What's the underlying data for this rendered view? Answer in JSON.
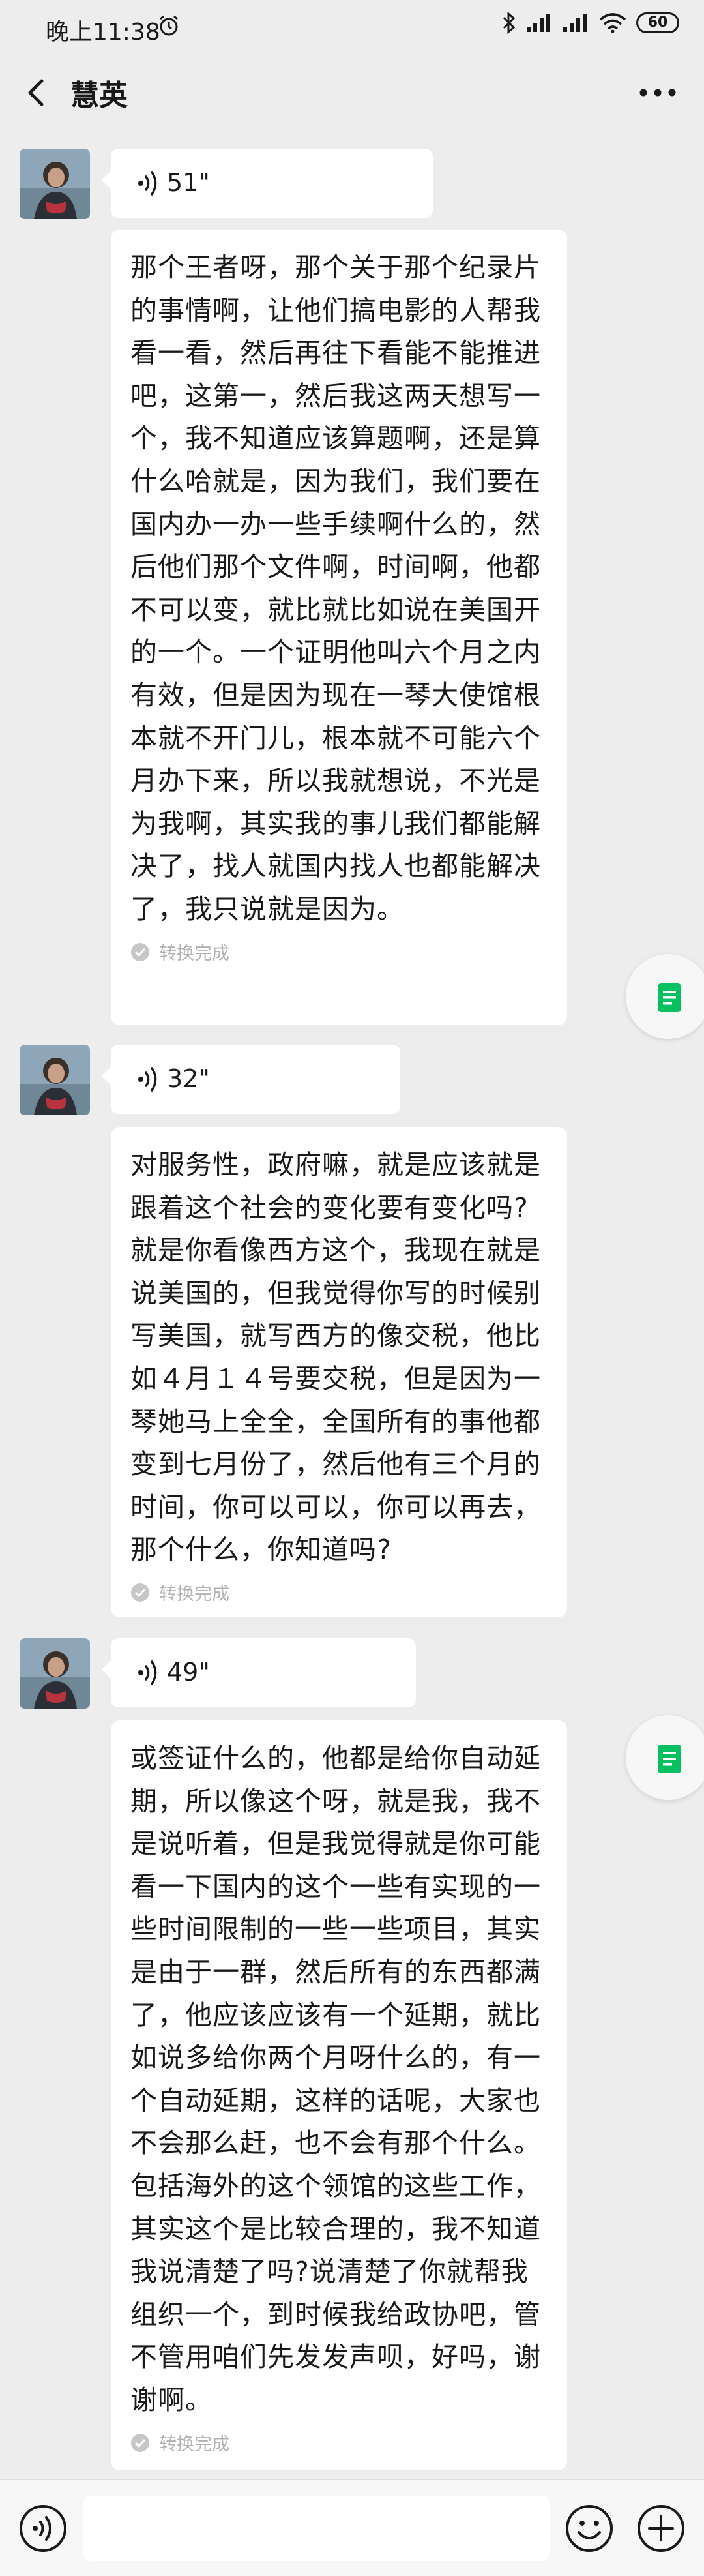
{
  "status_bar": {
    "time": "晚上11:38",
    "battery": "60"
  },
  "header": {
    "title": "慧英"
  },
  "messages": [
    {
      "duration": "51\"",
      "transcript": "那个王者呀，那个关于那个纪录片的事情啊，让他们搞电影的人帮我看一看，然后再往下看能不能推进吧，这第一，然后我这两天想写一个，我不知道应该算题啊，还是算什么哈就是，因为我们，我们要在国内办一办一些手续啊什么的，然后他们那个文件啊，时间啊，他都不可以变，就比就比如说在美国开的一个。一个证明他叫六个月之内有效，但是因为现在一琴大使馆根本就不开门儿，根本就不可能六个月办下来，所以我就想说，不光是为我啊，其实我的事儿我们都能解决了，找人就国内找人也都能解决了，我只说就是因为。",
      "status": "转换完成"
    },
    {
      "duration": "32\"",
      "transcript": "对服务性，政府嘛，就是应该就是跟着这个社会的变化要有变化吗?就是你看像西方这个，我现在就是说美国的，但我觉得你写的时候别写美国，就写西方的像交税，他比如４月１４号要交税，但是因为一琴她马上全全，全国所有的事他都变到七月份了，然后他有三个月的时间，你可以可以，你可以再去，那个什么，你知道吗?",
      "status": "转换完成"
    },
    {
      "duration": "49\"",
      "transcript": "或签证什么的，他都是给你自动延期，所以像这个呀，就是我，我不是说听着，但是我觉得就是你可能看一下国内的这个一些有实现的一些时间限制的一些一些项目，其实是由于一群，然后所有的东西都满了，他应该应该有一个延期，就比如说多给你两个月呀什么的，有一个自动延期，这样的话呢，大家也不会那么赶，也不会有那个什么。包括海外的这个领馆的这些工作，其实这个是比较合理的，我不知道我说清楚了吗?说清楚了你就帮我组织一个，到时候我给政协吧，管不管用咱们先发发声呗，好吗，谢谢啊。",
      "status": "转换完成"
    }
  ],
  "input": {
    "placeholder": ""
  },
  "icons": {
    "back": "chevron-left-icon",
    "more": "more-dots-icon",
    "voice": "voice-wave-icon",
    "check": "check-circle-icon",
    "side_tab": "document-icon",
    "emoji": "emoji-icon",
    "plus": "plus-icon"
  },
  "colors": {
    "accent": "#07c160",
    "bubble": "#ffffff",
    "background": "#ededed",
    "muted": "#b2b2b2"
  }
}
